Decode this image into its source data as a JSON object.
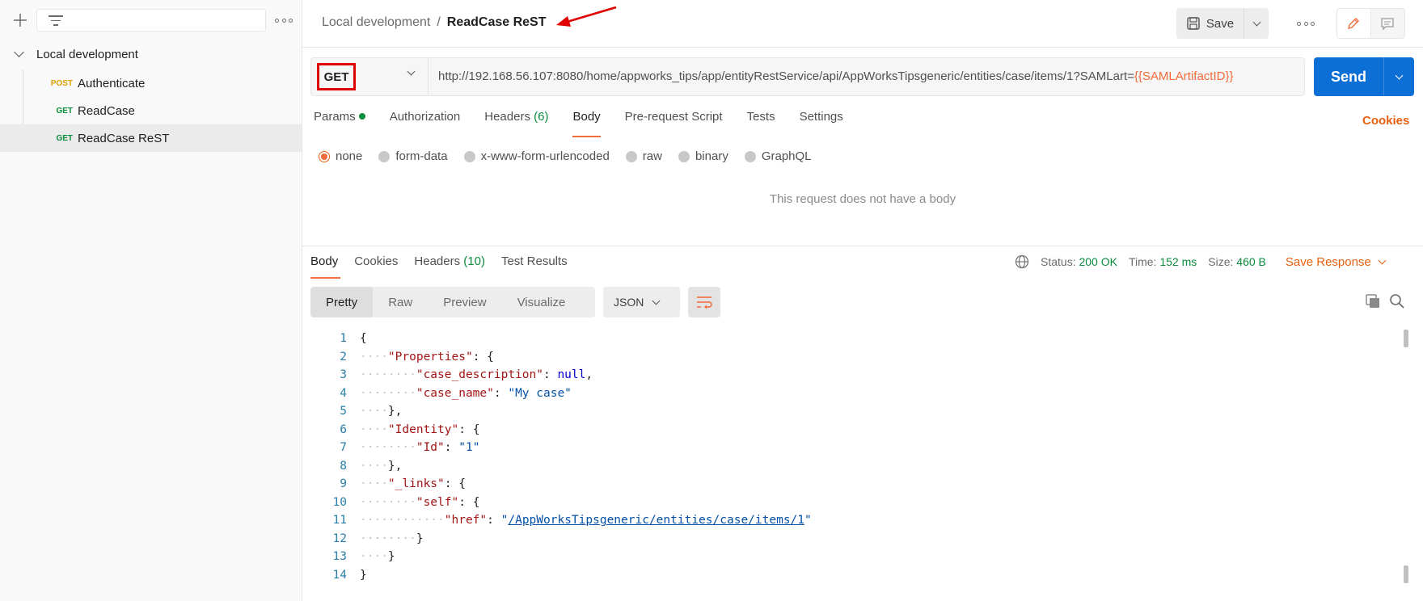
{
  "sidebar": {
    "collection": "Local development",
    "items": [
      {
        "method": "POST",
        "label": "Authenticate"
      },
      {
        "method": "GET",
        "label": "ReadCase"
      },
      {
        "method": "GET",
        "label": "ReadCase ReST"
      }
    ]
  },
  "header": {
    "breadcrumb_parent": "Local development",
    "breadcrumb_separator": "/",
    "breadcrumb_current": "ReadCase ReST",
    "save_label": "Save"
  },
  "request": {
    "method": "GET",
    "url_prefix": "http://192.168.56.107:8080/home/appworks_tips/app/entityRestService/api/AppWorksTipsgeneric/entities/case/items/1?SAMLart=",
    "url_variable": "{{SAMLArtifactID}}",
    "send_label": "Send",
    "tabs": [
      {
        "label": "Params",
        "has_dot": true
      },
      {
        "label": "Authorization"
      },
      {
        "label": "Headers",
        "count": "(6)"
      },
      {
        "label": "Body"
      },
      {
        "label": "Pre-request Script"
      },
      {
        "label": "Tests"
      },
      {
        "label": "Settings"
      }
    ],
    "cookies_label": "Cookies",
    "body_types": [
      "none",
      "form-data",
      "x-www-form-urlencoded",
      "raw",
      "binary",
      "GraphQL"
    ],
    "no_body_text": "This request does not have a body"
  },
  "response": {
    "tabs": [
      {
        "label": "Body"
      },
      {
        "label": "Cookies"
      },
      {
        "label": "Headers",
        "count": "(10)"
      },
      {
        "label": "Test Results"
      }
    ],
    "status_label": "Status:",
    "status_value": "200 OK",
    "time_label": "Time:",
    "time_value": "152 ms",
    "size_label": "Size:",
    "size_value": "460 B",
    "save_response_label": "Save Response",
    "view_modes": [
      "Pretty",
      "Raw",
      "Preview",
      "Visualize"
    ],
    "format": "JSON",
    "code_line_numbers": [
      "1",
      "2",
      "3",
      "4",
      "5",
      "6",
      "7",
      "8",
      "9",
      "10",
      "11",
      "12",
      "13",
      "14"
    ],
    "json": {
      "properties_key": "\"Properties\"",
      "case_description_key": "\"case_description\"",
      "case_description_value": "null",
      "case_name_key": "\"case_name\"",
      "case_name_value": "\"My case\"",
      "identity_key": "\"Identity\"",
      "id_key": "\"Id\"",
      "id_value": "\"1\"",
      "links_key": "\"_links\"",
      "self_key": "\"self\"",
      "href_key": "\"href\"",
      "href_value": "/AppWorksTipsgeneric/entities/case/items/1"
    }
  },
  "colors": {
    "accent": "#f26b3a",
    "send": "#0b6fd6",
    "get": "#0a8c3c",
    "post": "#e0a000",
    "annotation": "#e00000"
  }
}
